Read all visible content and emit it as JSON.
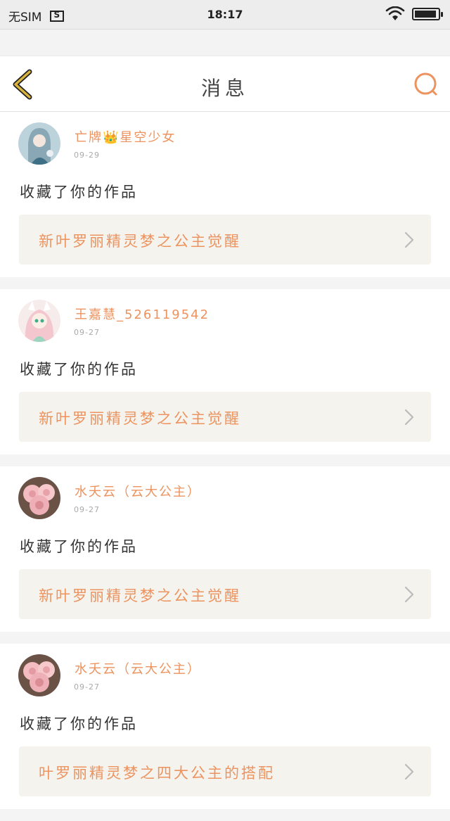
{
  "status_bar": {
    "carrier": "无SIM",
    "time": "18:17",
    "battery_level": 0.95
  },
  "nav": {
    "title": "消息",
    "back_icon": "chevron-left-icon",
    "search_icon": "search-icon"
  },
  "colors": {
    "accent": "#ec935f",
    "back_arrow": "#d8b43e",
    "card_bg": "#f4f3ee"
  },
  "messages": [
    {
      "username": "亡牌👑星空少女",
      "date": "09-29",
      "action": "收藏了你的作品",
      "work_title": "新叶罗丽精灵梦之公主觉醒",
      "avatar": "anime-girl-blue"
    },
    {
      "username": "王嘉慧_526119542",
      "date": "09-27",
      "action": "收藏了你的作品",
      "work_title": "新叶罗丽精灵梦之公主觉醒",
      "avatar": "anime-girl-pink"
    },
    {
      "username": "水夭云（云大公主）",
      "date": "09-27",
      "action": "收藏了你的作品",
      "work_title": "新叶罗丽精灵梦之公主觉醒",
      "avatar": "pink-roses"
    },
    {
      "username": "水夭云（云大公主）",
      "date": "09-27",
      "action": "收藏了你的作品",
      "work_title": "叶罗丽精灵梦之四大公主的搭配",
      "avatar": "pink-roses"
    }
  ]
}
